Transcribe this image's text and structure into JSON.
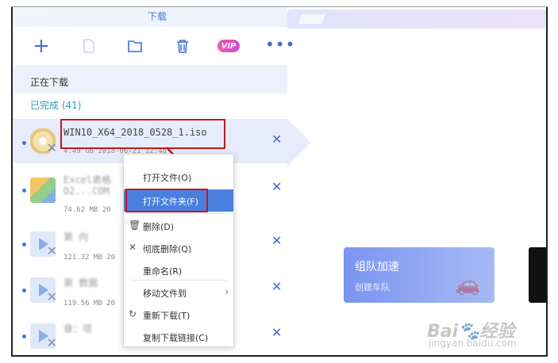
{
  "panel": {
    "title": "下载",
    "toolbar": {
      "new_icon": "plus-icon",
      "file_icon": "file-icon",
      "folder_icon": "folder-icon",
      "delete_icon": "trash-icon",
      "vip_label": "VIP",
      "more_label": "•••"
    },
    "section_downloading": "正在下载",
    "section_done": "已完成 (41)"
  },
  "items": [
    {
      "name": "WIN10_X64_2018_0528_1.iso",
      "meta": "4.49 GB   2018-06-21 12:48",
      "thumb": "disc"
    },
    {
      "name": "Excel表格",
      "name2": "D2...COM",
      "meta": "74.62 MB   20",
      "thumb": "excel"
    },
    {
      "name": "第  向",
      "meta": "121.32 MB  20",
      "thumb": "video"
    },
    {
      "name": "第    数据",
      "meta": "119.56 MB  20",
      "thumb": "video"
    },
    {
      "name": "章：项",
      "meta": "",
      "thumb": "video"
    }
  ],
  "context_menu": {
    "items": [
      {
        "label": "打开文件(O)",
        "icon": ""
      },
      {
        "label": "打开文件夹(F)",
        "icon": "",
        "active": true
      },
      {
        "label": "删除(D)",
        "icon": "trash-icon"
      },
      {
        "label": "彻底删除(Q)",
        "icon": "close-icon"
      },
      {
        "label": "重命名(R)",
        "icon": ""
      },
      {
        "label": "移动文件到",
        "icon": "",
        "submenu": true
      },
      {
        "label": "重新下载(T)",
        "icon": "refresh-icon"
      },
      {
        "label": "复制下载链接(C)",
        "icon": ""
      }
    ]
  },
  "right": {
    "team_title": "组队加速",
    "team_sub": "创建车队"
  },
  "watermark": {
    "line1": "Bai🐾经验",
    "line2": "jingyan.baidu.com"
  },
  "colors": {
    "accent": "#3a7bd5",
    "highlight_box": "#c8161d",
    "menu_active": "#4a7fe0"
  }
}
